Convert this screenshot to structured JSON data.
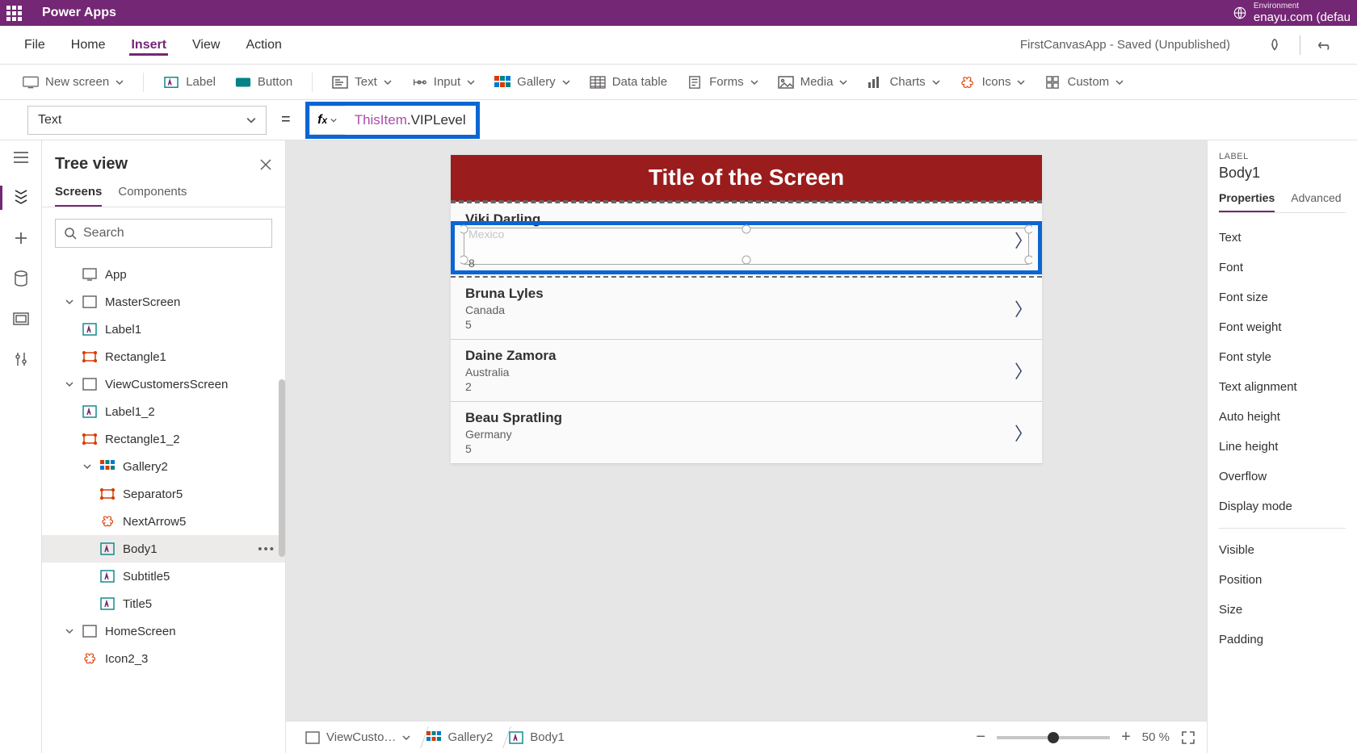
{
  "topbar": {
    "app_name": "Power Apps",
    "env_label": "Environment",
    "env_value": "enayu.com (defau"
  },
  "menubar": {
    "items": [
      "File",
      "Home",
      "Insert",
      "View",
      "Action"
    ],
    "active_index": 2,
    "saved_info": "FirstCanvasApp - Saved (Unpublished)"
  },
  "toolbar": {
    "new_screen": "New screen",
    "label": "Label",
    "button": "Button",
    "text": "Text",
    "input": "Input",
    "gallery": "Gallery",
    "data_table": "Data table",
    "forms": "Forms",
    "media": "Media",
    "charts": "Charts",
    "icons": "Icons",
    "custom": "Custom"
  },
  "formulabar": {
    "property": "Text",
    "formula_this": "ThisItem",
    "formula_rest": ".VIPLevel"
  },
  "tree": {
    "title": "Tree view",
    "tabs": [
      "Screens",
      "Components"
    ],
    "active_tab": 0,
    "search_placeholder": "Search",
    "nodes": [
      {
        "level": 1,
        "label": "App",
        "icon": "app",
        "expandable": false
      },
      {
        "level": 1,
        "label": "MasterScreen",
        "icon": "screen",
        "expandable": true,
        "expanded": true
      },
      {
        "level": 2,
        "label": "Label1",
        "icon": "label"
      },
      {
        "level": 2,
        "label": "Rectangle1",
        "icon": "rect"
      },
      {
        "level": 1,
        "label": "ViewCustomersScreen",
        "icon": "screen",
        "expandable": true,
        "expanded": true
      },
      {
        "level": 2,
        "label": "Label1_2",
        "icon": "label"
      },
      {
        "level": 2,
        "label": "Rectangle1_2",
        "icon": "rect"
      },
      {
        "level": 2,
        "label": "Gallery2",
        "icon": "gallery",
        "expandable": true,
        "expanded": true
      },
      {
        "level": 3,
        "label": "Separator5",
        "icon": "rect"
      },
      {
        "level": 3,
        "label": "NextArrow5",
        "icon": "iconnode"
      },
      {
        "level": 3,
        "label": "Body1",
        "icon": "label",
        "selected": true,
        "more": true
      },
      {
        "level": 3,
        "label": "Subtitle5",
        "icon": "label"
      },
      {
        "level": 3,
        "label": "Title5",
        "icon": "label"
      },
      {
        "level": 1,
        "label": "HomeScreen",
        "icon": "screen",
        "expandable": true,
        "expanded": true
      },
      {
        "level": 2,
        "label": "Icon2_3",
        "icon": "iconnode"
      }
    ]
  },
  "canvas": {
    "screen_title": "Title of the Screen",
    "rows": [
      {
        "name": "Viki  Darling",
        "sub": "Mexico",
        "vip": "8"
      },
      {
        "name": "Bruna  Lyles",
        "sub": "Canada",
        "vip": "5"
      },
      {
        "name": "Daine  Zamora",
        "sub": "Australia",
        "vip": "2"
      },
      {
        "name": "Beau  Spratling",
        "sub": "Germany",
        "vip": "5"
      }
    ],
    "breadcrumb": [
      {
        "label": "ViewCusto…",
        "icon": "screen",
        "dropdown": true
      },
      {
        "label": "Gallery2",
        "icon": "gallery"
      },
      {
        "label": "Body1",
        "icon": "label"
      }
    ],
    "zoom": "50  %"
  },
  "properties": {
    "type_label": "LABEL",
    "name": "Body1",
    "tabs": [
      "Properties",
      "Advanced"
    ],
    "active_tab": 0,
    "group1": [
      "Text",
      "Font",
      "Font size",
      "Font weight",
      "Font style",
      "Text alignment",
      "Auto height",
      "Line height",
      "Overflow",
      "Display mode"
    ],
    "group2": [
      "Visible",
      "Position",
      "Size",
      "Padding"
    ]
  }
}
